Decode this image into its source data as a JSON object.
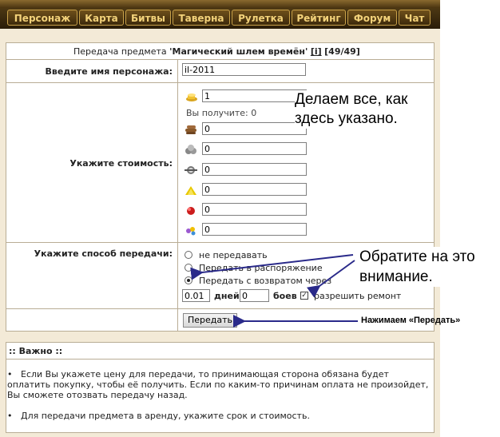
{
  "nav": {
    "items": [
      "Персонаж",
      "Карта",
      "Битвы",
      "Таверна",
      "Рулетка",
      "Рейтинг",
      "Форум",
      "Чат"
    ]
  },
  "header": {
    "prefix": "Передача предмета ",
    "item_name": "'Магический шлем времён'",
    "info_link": "[i]",
    "durability": "[49/49]"
  },
  "recipient": {
    "label": "Введите имя персонажа:",
    "value": "il-2011"
  },
  "price": {
    "label": "Укажите стоимость:",
    "you_get": "Вы получите: 0",
    "fields": [
      {
        "icon": "gold-icon",
        "value": "1"
      },
      {
        "icon": "wood-icon",
        "value": "0"
      },
      {
        "icon": "ore-icon",
        "value": "0"
      },
      {
        "icon": "mercury-icon",
        "value": "0"
      },
      {
        "icon": "sulfur-icon",
        "value": "0"
      },
      {
        "icon": "crystal-icon",
        "value": "0"
      },
      {
        "icon": "gems-icon",
        "value": "0"
      }
    ]
  },
  "transfer": {
    "label": "Укажите способ передачи:",
    "options": [
      "не передавать",
      "Передать в распоряжение",
      "Передать с возвратом через"
    ],
    "selected_index": 2,
    "days_value": "0.01",
    "days_label": "дней",
    "battles_value": "0",
    "battles_label": "боев",
    "repair_label": "разрешить ремонт",
    "repair_checked": true
  },
  "submit_label": "Передать",
  "important": {
    "title": ":: Важно ::",
    "notes": [
      "Если Вы укажете цену для передачи, то принимающая сторона обязана будет оплатить покупку, чтобы её получить. Если по каким-то причинам оплата не произойдет, Вы сможете отозвать передачу назад.",
      "Для передачи предмета в аренду, укажите срок и стоимость."
    ],
    "note1_lines": [
      "Если Вы укажете цену для передачи, то принимающая сторона обязана будет",
      "оплатить покупку, чтобы её получить. Если по каким-то причинам оплата не произойдет,",
      "Вы сможете отозвать передачу назад."
    ]
  },
  "annotations": {
    "do_as_shown_1": "Делаем все, как",
    "do_as_shown_2": "здесь указано.",
    "attention_1": "Обратите на это",
    "attention_2": "внимание.",
    "press_transfer": "Нажимаем «Передать»"
  },
  "colors": {
    "nav_text": "#f3d27a",
    "panel_bg": "#f3ead7",
    "border": "#b9ad95",
    "arrow": "#2a2a8a"
  }
}
